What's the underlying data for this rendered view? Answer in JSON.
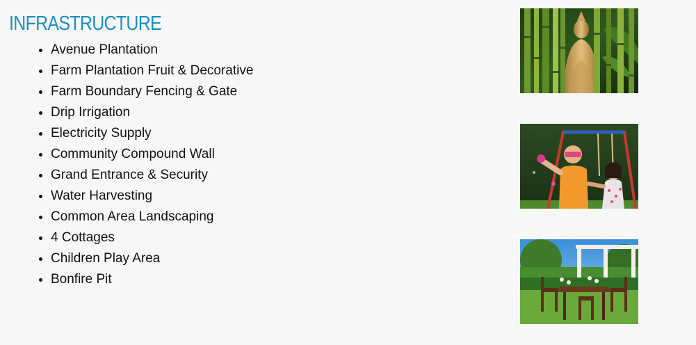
{
  "section": {
    "title": "INFRASTRUCTURE"
  },
  "items": [
    "Avenue Plantation",
    "Farm Plantation Fruit & Decorative",
    "Farm Boundary Fencing & Gate",
    "Drip Irrigation",
    "Electricity Supply",
    "Community Compound Wall",
    "Grand Entrance & Security",
    "Water Harvesting",
    "Common Area Landscaping",
    "4 Cottages",
    "Children Play Area",
    "Bonfire Pit"
  ]
}
